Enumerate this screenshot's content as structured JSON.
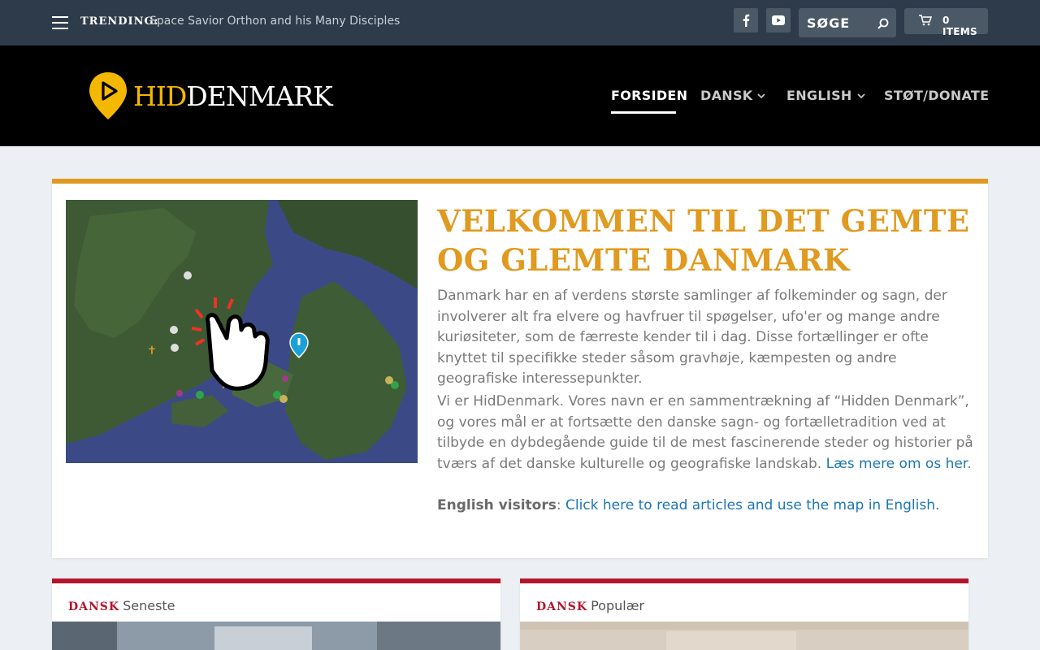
{
  "topbar": {
    "trending_label": "TRENDING:",
    "trending_text": "Space Savior Orthon and his Many Disciples",
    "search_placeholder": "SØGE",
    "cart_label": "0 ITEMS"
  },
  "header": {
    "logo_hid": "HID",
    "logo_rest": "DENMARK",
    "nav": [
      {
        "label": "FORSIDEN",
        "active": true
      },
      {
        "label": "DANSK",
        "has_dropdown": true
      },
      {
        "label": "ENGLISH",
        "has_dropdown": true
      },
      {
        "label": "STØT/DONATE"
      }
    ]
  },
  "welcome": {
    "title": "VELKOMMEN TIL DET GEMTE OG GLEMTE DANMARK",
    "para1": "Danmark har en af verdens største samlinger af folkeminder og sagn, der involverer alt fra elvere og havfruer til spøgelser, ufo'er og mange andre kuriøsiteter, som de færreste kender til i dag. Disse fortællinger er ofte knyttet til specifikke steder såsom gravhøje, kæmpesten og andre geografiske interessepunkter.",
    "para2": "Vi er HidDenmark. Vores navn er en sammentrækning af “Hidden Denmark”, og vores mål er at fortsætte den danske sagn- og fortælletradition ved at tilbyde en dybdegående guide til de mest fascinerende steder og historier på tværs af det danske kulturelle og geografiske landskab.",
    "para2_link": "Læs mere om os her",
    "para2_end": ".",
    "para3_bold": "English visitors",
    "para3_sep": ": ",
    "para3_link": "Click here to read articles and use the map in English."
  },
  "cards": [
    {
      "tag": "DANSK",
      "title": "Seneste"
    },
    {
      "tag": "DANSK",
      "title": "Populær"
    }
  ],
  "colors": {
    "accent_orange": "#e09a1f",
    "accent_red": "#b5152c",
    "link_blue": "#1d76b5",
    "topbar_bg": "#2e3b4a"
  },
  "icons": [
    "menu-icon",
    "facebook-icon",
    "youtube-icon",
    "search-icon",
    "cart-icon",
    "chevron-down-icon",
    "map-pin-icon",
    "pointing-hand-icon"
  ]
}
